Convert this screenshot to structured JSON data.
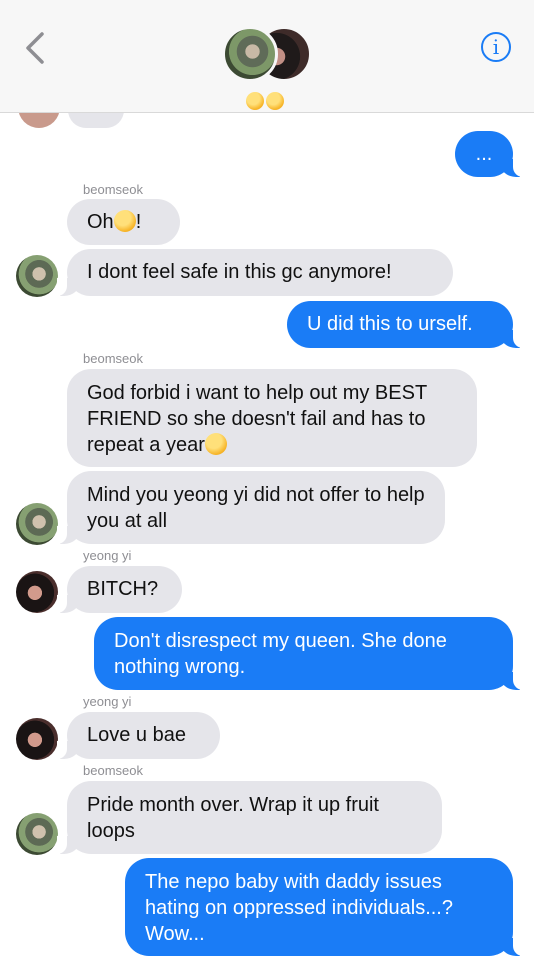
{
  "header": {
    "back_glyph": "‹",
    "info_glyph": "i",
    "group_emoji": [
      "😳",
      "😳"
    ]
  },
  "messages": [
    {
      "id": "m1",
      "dir": "out",
      "text": "..."
    },
    {
      "id": "n1",
      "sender_label": "beomseok"
    },
    {
      "id": "m2",
      "dir": "in",
      "text": "Oh",
      "emoji_after": "😊",
      "trail": "!"
    },
    {
      "id": "m3",
      "dir": "in",
      "text": "I dont feel safe in this gc anymore!"
    },
    {
      "id": "m4",
      "dir": "out",
      "text": "U did this to urself."
    },
    {
      "id": "n2",
      "sender_label": "beomseok"
    },
    {
      "id": "m5",
      "dir": "in",
      "text": "God forbid i want to help out my BEST FRIEND so she doesn't fail and has to repeat a year",
      "emoji_after": "😕"
    },
    {
      "id": "m6",
      "dir": "in",
      "text": "Mind you yeong yi did not offer to help you at all"
    },
    {
      "id": "n3",
      "sender_label": "yeong yi"
    },
    {
      "id": "m7",
      "dir": "in",
      "text": "BITCH?"
    },
    {
      "id": "m8",
      "dir": "out",
      "text": "Don't disrespect my queen. She done nothing wrong."
    },
    {
      "id": "n4",
      "sender_label": "yeong yi"
    },
    {
      "id": "m9",
      "dir": "in",
      "text": "Love u bae"
    },
    {
      "id": "n5",
      "sender_label": "beomseok"
    },
    {
      "id": "m10",
      "dir": "in",
      "text": "Pride month over. Wrap it up fruit loops"
    },
    {
      "id": "m11",
      "dir": "out",
      "text": "The nepo baby with daddy issues hating on oppressed individuals...? Wow..."
    }
  ],
  "colors": {
    "outgoing_bubble": "#1a7cf6",
    "incoming_bubble": "#e5e5ea",
    "sender_label": "#8e8e93"
  }
}
